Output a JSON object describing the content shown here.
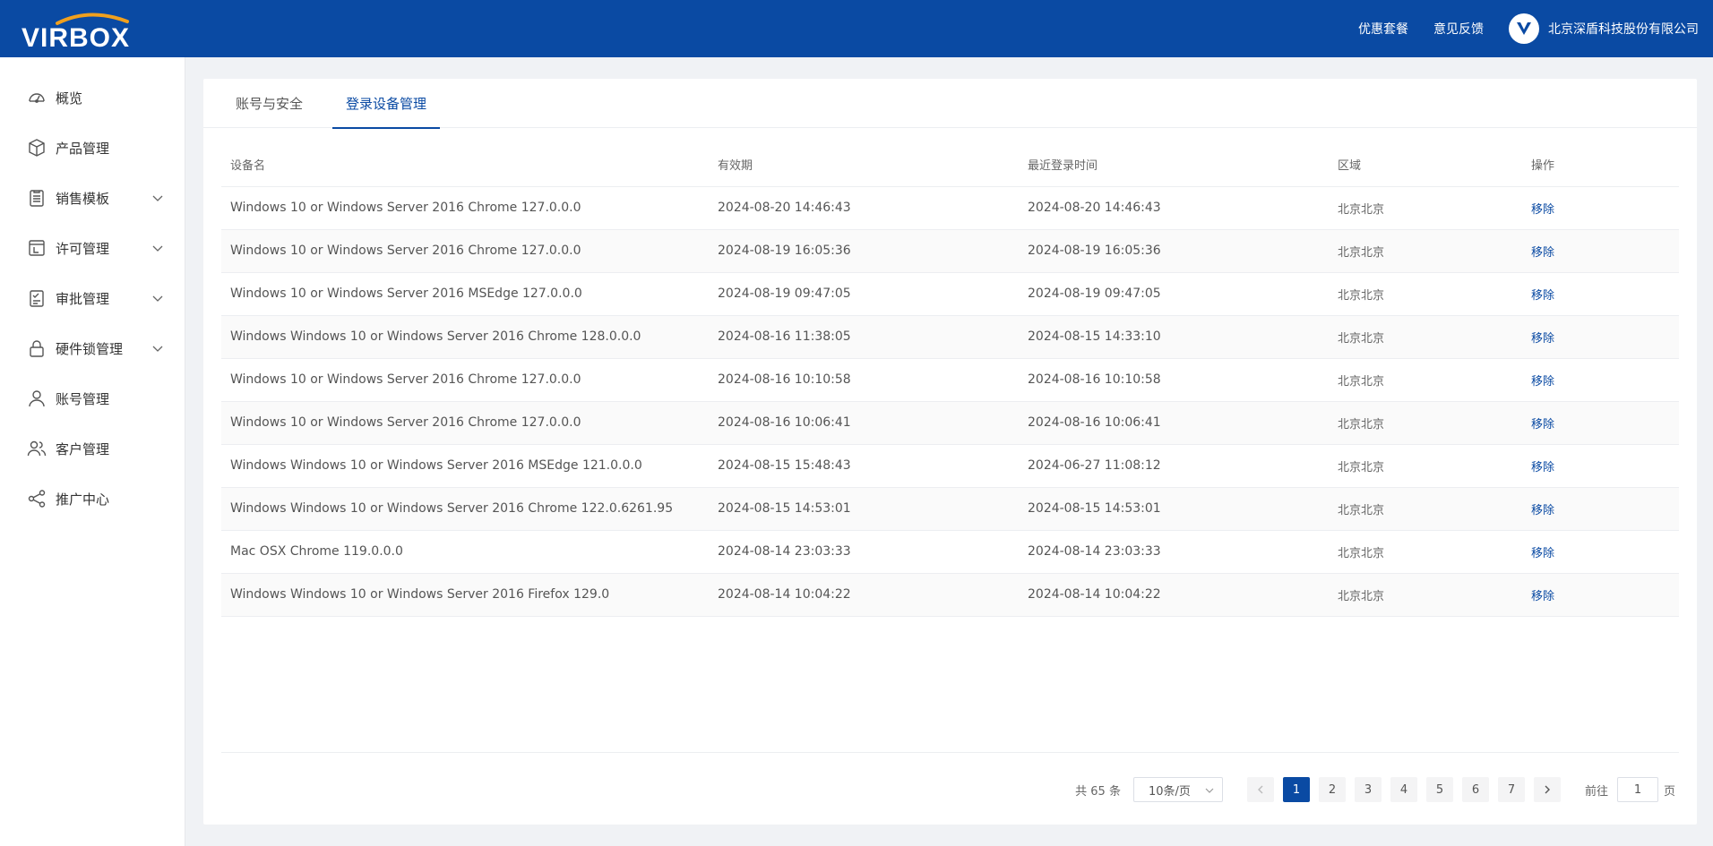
{
  "header": {
    "logo_text": "VIRBOX",
    "links": [
      "优惠套餐",
      "意见反馈"
    ],
    "company": "北京深盾科技股份有限公司",
    "brand_color": "#0a4aa3"
  },
  "sidebar": {
    "items": [
      {
        "label": "概览",
        "icon": "dashboard-icon",
        "expandable": false
      },
      {
        "label": "产品管理",
        "icon": "box-icon",
        "expandable": false
      },
      {
        "label": "销售模板",
        "icon": "clipboard-icon",
        "expandable": true
      },
      {
        "label": "许可管理",
        "icon": "license-icon",
        "expandable": true
      },
      {
        "label": "审批管理",
        "icon": "approval-icon",
        "expandable": true
      },
      {
        "label": "硬件锁管理",
        "icon": "lock-icon",
        "expandable": true
      },
      {
        "label": "账号管理",
        "icon": "user-icon",
        "expandable": false
      },
      {
        "label": "客户管理",
        "icon": "users-icon",
        "expandable": false
      },
      {
        "label": "推广中心",
        "icon": "share-icon",
        "expandable": false
      }
    ]
  },
  "tabs": [
    {
      "label": "账号与安全",
      "active": false
    },
    {
      "label": "登录设备管理",
      "active": true
    }
  ],
  "table": {
    "columns": [
      "设备名",
      "有效期",
      "最近登录时间",
      "区域",
      "操作"
    ],
    "rows": [
      [
        "Windows 10 or Windows Server 2016 Chrome 127.0.0.0",
        "2024-08-20 14:46:43",
        "2024-08-20 14:46:43",
        "北京北京",
        "移除"
      ],
      [
        "Windows 10 or Windows Server 2016 Chrome 127.0.0.0",
        "2024-08-19 16:05:36",
        "2024-08-19 16:05:36",
        "北京北京",
        "移除"
      ],
      [
        "Windows 10 or Windows Server 2016 MSEdge 127.0.0.0",
        "2024-08-19 09:47:05",
        "2024-08-19 09:47:05",
        "北京北京",
        "移除"
      ],
      [
        "Windows Windows 10 or Windows Server 2016 Chrome 128.0.0.0",
        "2024-08-16 11:38:05",
        "2024-08-15 14:33:10",
        "北京北京",
        "移除"
      ],
      [
        "Windows 10 or Windows Server 2016 Chrome 127.0.0.0",
        "2024-08-16 10:10:58",
        "2024-08-16 10:10:58",
        "北京北京",
        "移除"
      ],
      [
        "Windows 10 or Windows Server 2016 Chrome 127.0.0.0",
        "2024-08-16 10:06:41",
        "2024-08-16 10:06:41",
        "北京北京",
        "移除"
      ],
      [
        "Windows Windows 10 or Windows Server 2016 MSEdge 121.0.0.0",
        "2024-08-15 15:48:43",
        "2024-06-27 11:08:12",
        "北京北京",
        "移除"
      ],
      [
        "Windows Windows 10 or Windows Server 2016 Chrome 122.0.6261.95",
        "2024-08-15 14:53:01",
        "2024-08-15 14:53:01",
        "北京北京",
        "移除"
      ],
      [
        "Mac OSX Chrome 119.0.0.0",
        "2024-08-14 23:03:33",
        "2024-08-14 23:03:33",
        "北京北京",
        "移除"
      ],
      [
        "Windows Windows 10 or Windows Server 2016 Firefox 129.0",
        "2024-08-14 10:04:22",
        "2024-08-14 10:04:22",
        "北京北京",
        "移除"
      ]
    ]
  },
  "pagination": {
    "total": "共 65 条",
    "page_size": "10条/页",
    "pages": [
      "1",
      "2",
      "3",
      "4",
      "5",
      "6",
      "7"
    ],
    "current": "1",
    "goto_label": "前往",
    "goto_value": "1",
    "page_unit": "页"
  }
}
